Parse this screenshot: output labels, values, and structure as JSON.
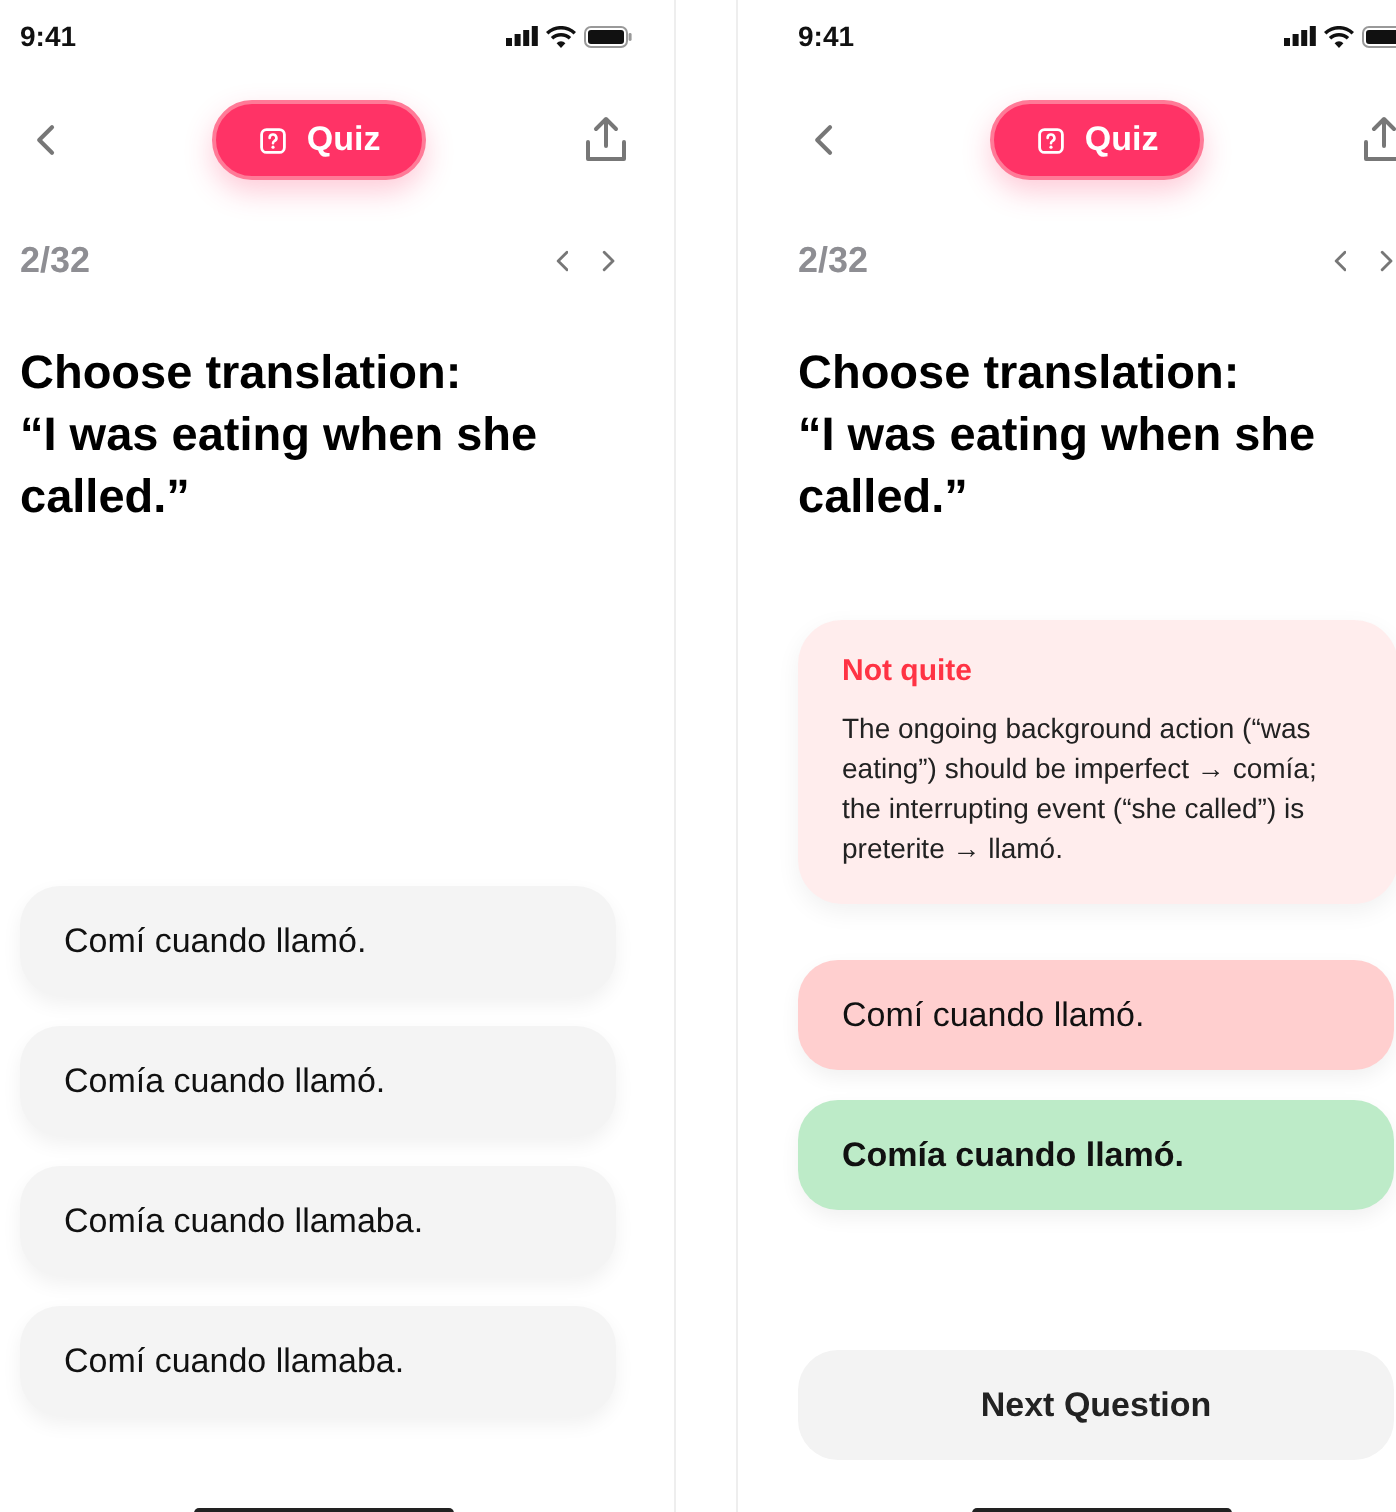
{
  "screens": [
    {
      "status_time": "9:41",
      "mode_button": "Quiz",
      "counter": "2/32",
      "question": "Choose translation:\n“I was eating when she called.”",
      "options": [
        {
          "text": "Comí cuando llamó.",
          "kind": "neutral"
        },
        {
          "text": "Comía cuando llamó.",
          "kind": "neutral"
        },
        {
          "text": "Comía cuando llamaba.",
          "kind": "neutral"
        },
        {
          "text": "Comí cuando llamaba.",
          "kind": "neutral"
        }
      ]
    },
    {
      "status_time": "9:41",
      "mode_button": "Quiz",
      "counter": "2/32",
      "question": "Choose translation:\n“I was eating when she called.”",
      "feedback": {
        "title": "Not quite",
        "body": "The ongoing background action (“was eating”) should be imperfect → comía; the interrupting event (“she called”) is preterite → llamó."
      },
      "options": [
        {
          "text": "Comí cuando llamó.",
          "kind": "wrong"
        },
        {
          "text": "Comía cuando llamó.",
          "kind": "correct"
        }
      ],
      "next_button": "Next Question"
    }
  ]
}
